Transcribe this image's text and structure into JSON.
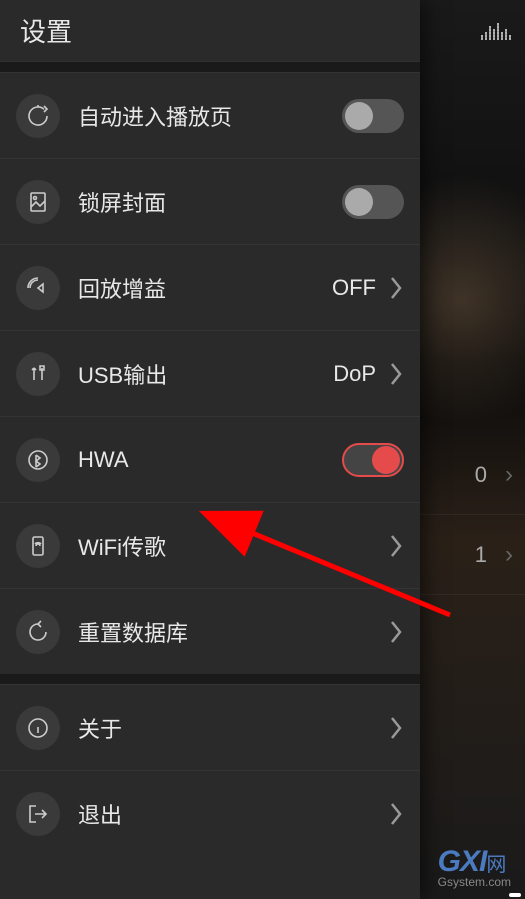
{
  "header": {
    "title": "设置"
  },
  "settings": {
    "auto_play": {
      "label": "自动进入播放页",
      "enabled": false
    },
    "lock_cover": {
      "label": "锁屏封面",
      "enabled": false
    },
    "replay_gain": {
      "label": "回放增益",
      "value": "OFF"
    },
    "usb_output": {
      "label": "USB输出",
      "value": "DoP"
    },
    "hwa": {
      "label": "HWA",
      "enabled": true
    },
    "wifi_transfer": {
      "label": "WiFi传歌"
    },
    "rebuild_db": {
      "label": "重置数据库"
    },
    "about": {
      "label": "关于"
    },
    "exit": {
      "label": "退出"
    }
  },
  "background_list": [
    {
      "count": "0"
    },
    {
      "count": "1"
    }
  ],
  "watermark": {
    "brand": "GXI",
    "suffix": "网",
    "url": "Gsystem.com"
  }
}
